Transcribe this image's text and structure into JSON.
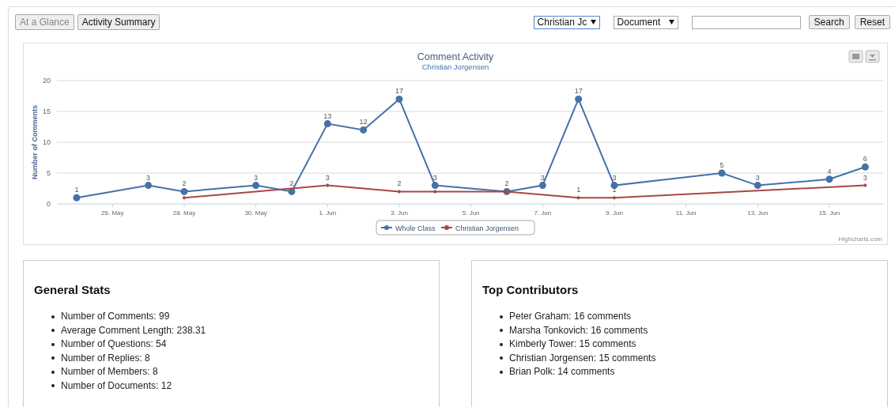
{
  "tabs": [
    {
      "label": "At a Glance",
      "selected": true
    },
    {
      "label": "Activity Summary",
      "selected": false
    }
  ],
  "filters": [
    {
      "value": "Christian Jc",
      "focused": true
    },
    {
      "value": "Document",
      "focused": false
    }
  ],
  "search": {
    "button": "Search"
  },
  "reset": "Reset",
  "chart": {
    "credits": "Highcharts.com",
    "chart_data": {
      "type": "line",
      "title": "Comment Activity",
      "subtitle": "Christian Jorgensen",
      "ylabel": "Number of Comments",
      "categories": [
        null,
        "26. May",
        null,
        "28. May",
        null,
        "30. May",
        null,
        "1. Jun",
        null,
        "3. Jun",
        null,
        "5. Jun",
        null,
        "7. Jun",
        null,
        "9. Jun",
        null,
        "11. Jun",
        null,
        "13. Jun",
        null,
        "15. Jun",
        null
      ],
      "yticks": [
        0,
        5,
        10,
        15,
        20
      ],
      "ylim": [
        0,
        20
      ],
      "grid": true,
      "legend": "bottom",
      "series": [
        {
          "name": "Whole Class",
          "color": "#4572a7",
          "marker": "circle",
          "values": [
            1,
            null,
            3,
            2,
            null,
            3,
            2,
            13,
            12,
            17,
            3,
            null,
            2,
            3,
            17,
            3,
            null,
            null,
            5,
            3,
            null,
            4,
            6
          ],
          "value_labels": [
            "1",
            null,
            "3",
            "2",
            null,
            "3",
            "2",
            "13",
            "12",
            "17",
            "3",
            null,
            "2",
            "3",
            "17",
            "3",
            null,
            null,
            "5",
            "3",
            null,
            "4",
            "6"
          ]
        },
        {
          "name": "Christian Jorgensen",
          "color": "#aa4643",
          "marker": "diamond",
          "values": [
            null,
            null,
            null,
            1,
            null,
            null,
            null,
            3,
            null,
            2,
            2,
            null,
            2,
            null,
            1,
            1,
            null,
            null,
            null,
            null,
            null,
            null,
            3
          ],
          "value_labels": [
            null,
            null,
            null,
            null,
            null,
            null,
            null,
            "3",
            null,
            "2",
            null,
            null,
            null,
            null,
            "1",
            "1",
            null,
            null,
            null,
            null,
            null,
            null,
            "3"
          ]
        }
      ]
    }
  },
  "general_stats": {
    "title": "General Stats",
    "items": [
      "Number of Comments: 99",
      "Average Comment Length: 238.31",
      "Number of Questions: 54",
      "Number of Replies: 8",
      "Number of Members: 8",
      "Number of Documents: 12"
    ]
  },
  "top_contributors": {
    "title": "Top Contributors",
    "items": [
      "Peter Graham: 16 comments",
      "Marsha Tonkovich: 16 comments",
      "Kimberly Tower: 15 comments",
      "Christian Jorgensen: 15 comments",
      "Brian Polk: 14 comments"
    ]
  }
}
